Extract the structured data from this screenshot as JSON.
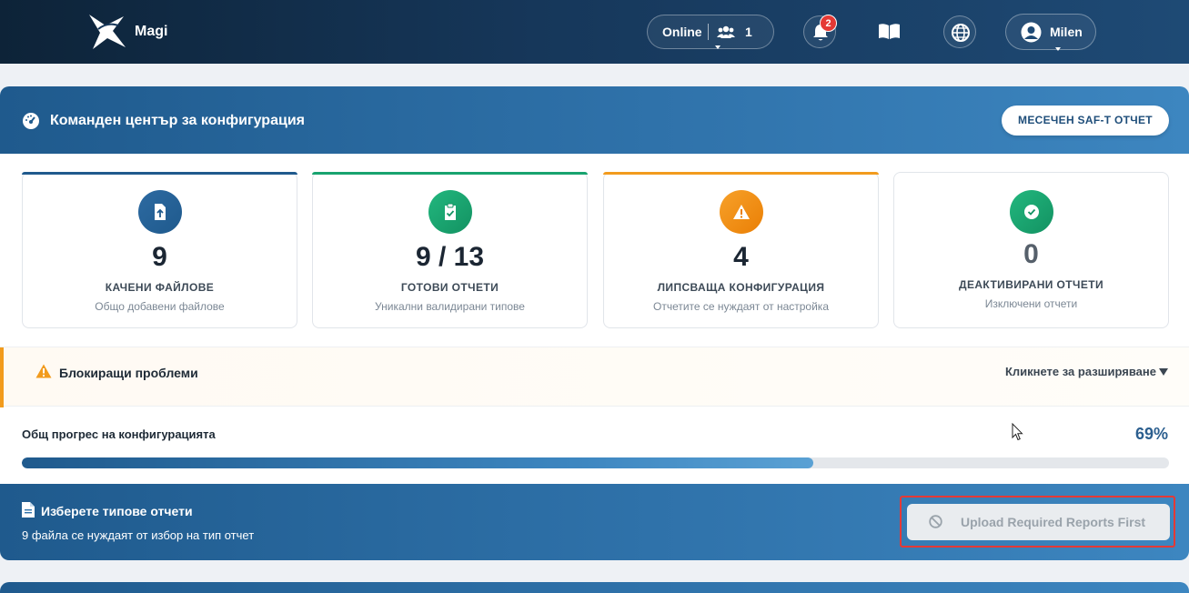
{
  "header": {
    "brand": "Magi",
    "online_label": "Online",
    "online_count": "1",
    "notifications_count": "2",
    "user_name": "Milen"
  },
  "command_center": {
    "title": "Команден център за конфигурация",
    "saft_button": "МЕСЕЧЕН SAF-T ОТЧЕТ"
  },
  "stats": [
    {
      "value": "9",
      "label": "КАЧЕНИ ФАЙЛОВЕ",
      "sub": "Общо добавени файлове",
      "color": "#1f5a8d",
      "icon": "file-upload-icon"
    },
    {
      "value": "9 / 13",
      "label": "ГОТОВИ ОТЧЕТИ",
      "sub": "Уникални валидирани типове",
      "color": "#18a36f",
      "icon": "clipboard-check-icon"
    },
    {
      "value": "4",
      "label": "ЛИПСВАЩА КОНФИГУРАЦИЯ",
      "sub": "Отчетите се нуждаят от настройка",
      "color": "#f08a0b",
      "icon": "warning-icon"
    },
    {
      "value": "0",
      "label": "ДЕАКТИВИРАНИ ОТЧЕТИ",
      "sub": "Изключени отчети",
      "color": "#18a36f",
      "icon": "check-circle-icon"
    }
  ],
  "blocking": {
    "title": "Блокиращи проблеми",
    "expand": "Кликнете за разширяване"
  },
  "progress": {
    "label": "Общ прогрес на конфигурацията",
    "percent_text": "69%",
    "fraction": 0.69
  },
  "select_types": {
    "title": "Изберете типове отчети",
    "subtitle": "9 файла се нуждаят от избор на тип отчет",
    "upload_button": "Upload Required Reports First"
  },
  "colors": {
    "accent": "#2f72aa",
    "warning": "#f29b1d",
    "danger": "#e53935"
  }
}
